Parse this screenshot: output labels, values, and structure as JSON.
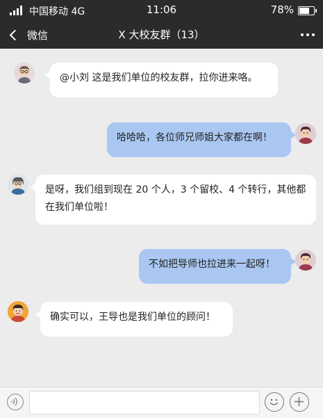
{
  "status_bar": {
    "carrier": "中国移动 4G",
    "time": "11:06",
    "battery_percent": "78%",
    "battery_level": 0.78
  },
  "nav": {
    "back_label": "微信",
    "title": "X 大校友群（13）"
  },
  "messages": [
    {
      "direction": "in",
      "text": "@小刘 这是我们单位的校友群，拉你进来咯。",
      "avatar": "avatar-glasses-man"
    },
    {
      "direction": "out",
      "text": "哈哈哈，各位师兄师姐大家都在啊！",
      "avatar": "avatar-self"
    },
    {
      "direction": "in",
      "text": "是呀，我们组到现在 20 个人，3 个留校、4 个转行，其他都在我们单位啦！",
      "avatar": "avatar-woman"
    },
    {
      "direction": "out",
      "text": "不如把导师也拉进来一起呀！",
      "avatar": "avatar-self"
    },
    {
      "direction": "in",
      "text": "确实可以，王导也是我们单位的顾问！",
      "avatar": "avatar-boy"
    }
  ],
  "input_bar": {
    "voice_icon": "voice-icon",
    "emoji_icon": "emoji-icon",
    "plus_icon": "plus-icon",
    "input_value": ""
  },
  "colors": {
    "header_bg": "#2b2b2d",
    "chat_bg": "#ececec",
    "incoming_bubble": "#ffffff",
    "outgoing_bubble": "#a9c7f1"
  }
}
